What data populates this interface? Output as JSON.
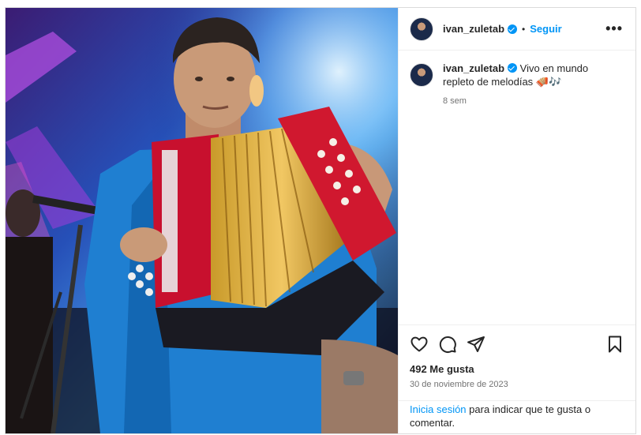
{
  "post": {
    "username": "ivan_zuletab",
    "follow_label": "Seguir",
    "more_label": "•••",
    "separator": "•",
    "caption_text": "Vivo en mundo repleto de melodías 🪗🎶",
    "caption_age": "8 sem",
    "likes": "492 Me gusta",
    "date": "30 de noviembre de 2023"
  },
  "login_prompt": {
    "link": "Inicia sesión",
    "text": " para indicar que te gusta o comentar."
  },
  "icons": {
    "like": "heart-icon",
    "comment": "comment-icon",
    "share": "share-icon",
    "save": "bookmark-icon",
    "verified": "verified-badge-icon"
  },
  "colors": {
    "accent": "#0095f6",
    "muted": "#737373",
    "accordion_red": "#c8102e",
    "shirt_blue": "#1f7fd1"
  }
}
